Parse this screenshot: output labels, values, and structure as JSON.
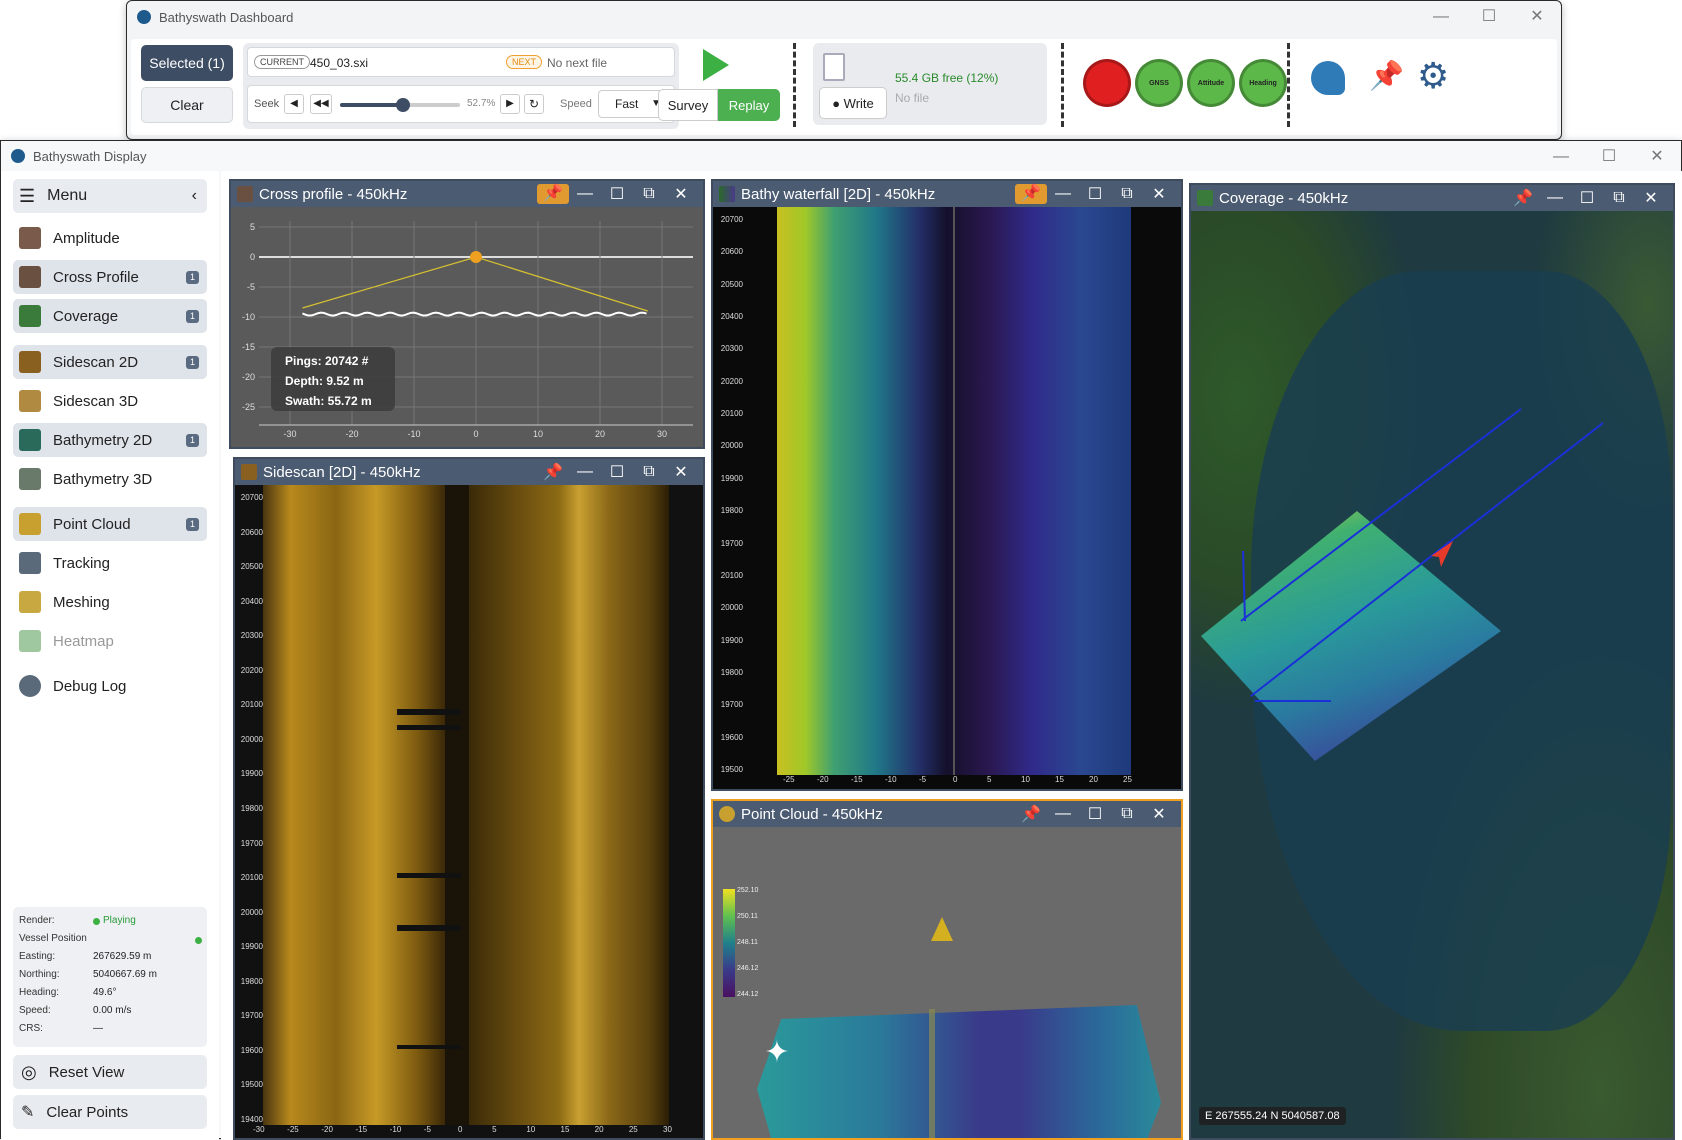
{
  "dashboard": {
    "title": "Bathyswath Dashboard",
    "selected_label": "Selected (1)",
    "clear_label": "Clear",
    "current_tag": "CURRENT",
    "current_file": "450_03.sxi",
    "next_tag": "NEXT",
    "next_file": "No next file",
    "seek_label": "Seek",
    "seek_pct": "52.7%",
    "seek_value": 0.527,
    "speed_label": "Speed",
    "speed_value": "Fast",
    "survey_label": "Survey",
    "replay_label": "Replay",
    "disk_free": "55.4 GB free (12%)",
    "no_file": "No file",
    "write_label": "● Write",
    "status_buttons": [
      {
        "name": "record",
        "label": "",
        "color": "#e02020"
      },
      {
        "name": "gnss",
        "label": "GNSS",
        "color": "#5db84a"
      },
      {
        "name": "attitude",
        "label": "Attitude",
        "color": "#5db84a"
      },
      {
        "name": "heading",
        "label": "Heading",
        "color": "#5db84a"
      }
    ]
  },
  "display": {
    "title": "Bathyswath Display"
  },
  "menu": {
    "title": "Menu",
    "items": [
      {
        "label": "Amplitude",
        "badge": ""
      },
      {
        "label": "Cross Profile",
        "badge": "1"
      },
      {
        "label": "Coverage",
        "badge": "1"
      },
      {
        "label": "Sidescan 2D",
        "badge": "1"
      },
      {
        "label": "Sidescan 3D",
        "badge": ""
      },
      {
        "label": "Bathymetry 2D",
        "badge": "1"
      },
      {
        "label": "Bathymetry 3D",
        "badge": ""
      },
      {
        "label": "Point Cloud",
        "badge": "1"
      },
      {
        "label": "Tracking",
        "badge": ""
      },
      {
        "label": "Meshing",
        "badge": ""
      },
      {
        "label": "Heatmap",
        "badge": ""
      },
      {
        "label": "Debug Log",
        "badge": ""
      }
    ]
  },
  "status": {
    "render_label": "Render:",
    "render_value": "Playing",
    "vessel_label": "Vessel Position",
    "easting_label": "Easting:",
    "easting": "267629.59 m",
    "northing_label": "Northing:",
    "northing": "5040667.69 m",
    "heading_label": "Heading:",
    "heading": "49.6°",
    "speed_label": "Speed:",
    "speed": "0.00 m/s",
    "crs_label": "CRS:",
    "crs": "—"
  },
  "actions": {
    "reset_view": "Reset View",
    "clear_points": "Clear Points"
  },
  "panes": {
    "cross_profile": "Cross profile - 450kHz",
    "bathy_waterfall": "Bathy waterfall [2D] - 450kHz",
    "coverage": "Coverage - 450kHz",
    "sidescan": "Sidescan [2D] - 450kHz",
    "point_cloud": "Point Cloud - 450kHz"
  },
  "cross_profile": {
    "pings": "Pings: 20742 #",
    "depth": "Depth: 9.52 m",
    "swath": "Swath: 55.72 m",
    "y_ticks": [
      "5",
      "0",
      "-5",
      "-10",
      "-15",
      "-20",
      "-25"
    ],
    "x_ticks": [
      "-30",
      "-20",
      "-10",
      "0",
      "10",
      "20",
      "30"
    ]
  },
  "waterfall": {
    "y_ticks": [
      "20700",
      "20600",
      "20500",
      "20400",
      "20300",
      "20200",
      "20100",
      "20000",
      "19900",
      "19800",
      "19700",
      "20100",
      "20000",
      "19900",
      "19800",
      "19700",
      "19600",
      "19500"
    ],
    "x_ticks": [
      "-25",
      "-20",
      "-15",
      "-10",
      "-5",
      "0",
      "5",
      "10",
      "15",
      "20",
      "25"
    ]
  },
  "sidescan": {
    "y_ticks": [
      "20700",
      "20600",
      "20500",
      "20400",
      "20300",
      "20200",
      "20100",
      "20000",
      "19900",
      "19800",
      "19700",
      "20100",
      "20000",
      "19900",
      "19800",
      "19700",
      "19600",
      "19500",
      "19400"
    ],
    "x_ticks": [
      "-30",
      "-25",
      "-20",
      "-15",
      "-10",
      "-5",
      "0",
      "5",
      "10",
      "15",
      "20",
      "25",
      "30"
    ]
  },
  "point_cloud": {
    "legend": [
      "252.10",
      "250.11",
      "248.11",
      "246.12",
      "244.12"
    ]
  },
  "coverage": {
    "coords": "E 267555.24  N 5040587.08"
  }
}
